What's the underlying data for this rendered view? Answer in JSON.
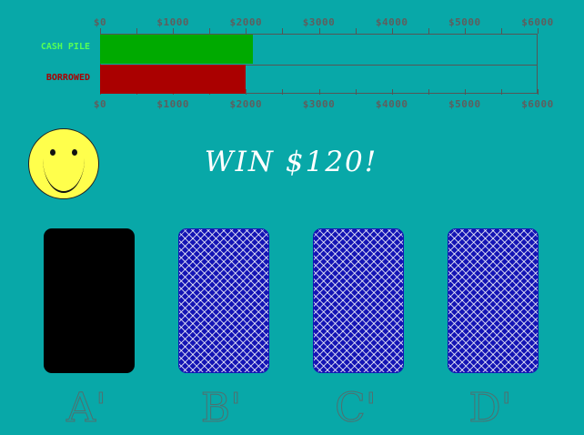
{
  "meter": {
    "axis_ticks": [
      "$0",
      "$1000",
      "$2000",
      "$3000",
      "$4000",
      "$5000",
      "$6000"
    ],
    "max": 6000,
    "bars": [
      {
        "label": "CASH PILE",
        "value": 2100,
        "color": "#00aa00",
        "label_color": "#55ff55"
      },
      {
        "label": "BORROWED",
        "value": 2000,
        "color": "#aa0000",
        "label_color": "#aa0000"
      }
    ]
  },
  "status": {
    "icon": "smiley-face-icon",
    "message": "WIN $120!"
  },
  "cards": [
    {
      "label": "A'",
      "state": "revealed"
    },
    {
      "label": "B'",
      "state": "face-down"
    },
    {
      "label": "C'",
      "state": "face-down"
    },
    {
      "label": "D'",
      "state": "face-down"
    }
  ]
}
